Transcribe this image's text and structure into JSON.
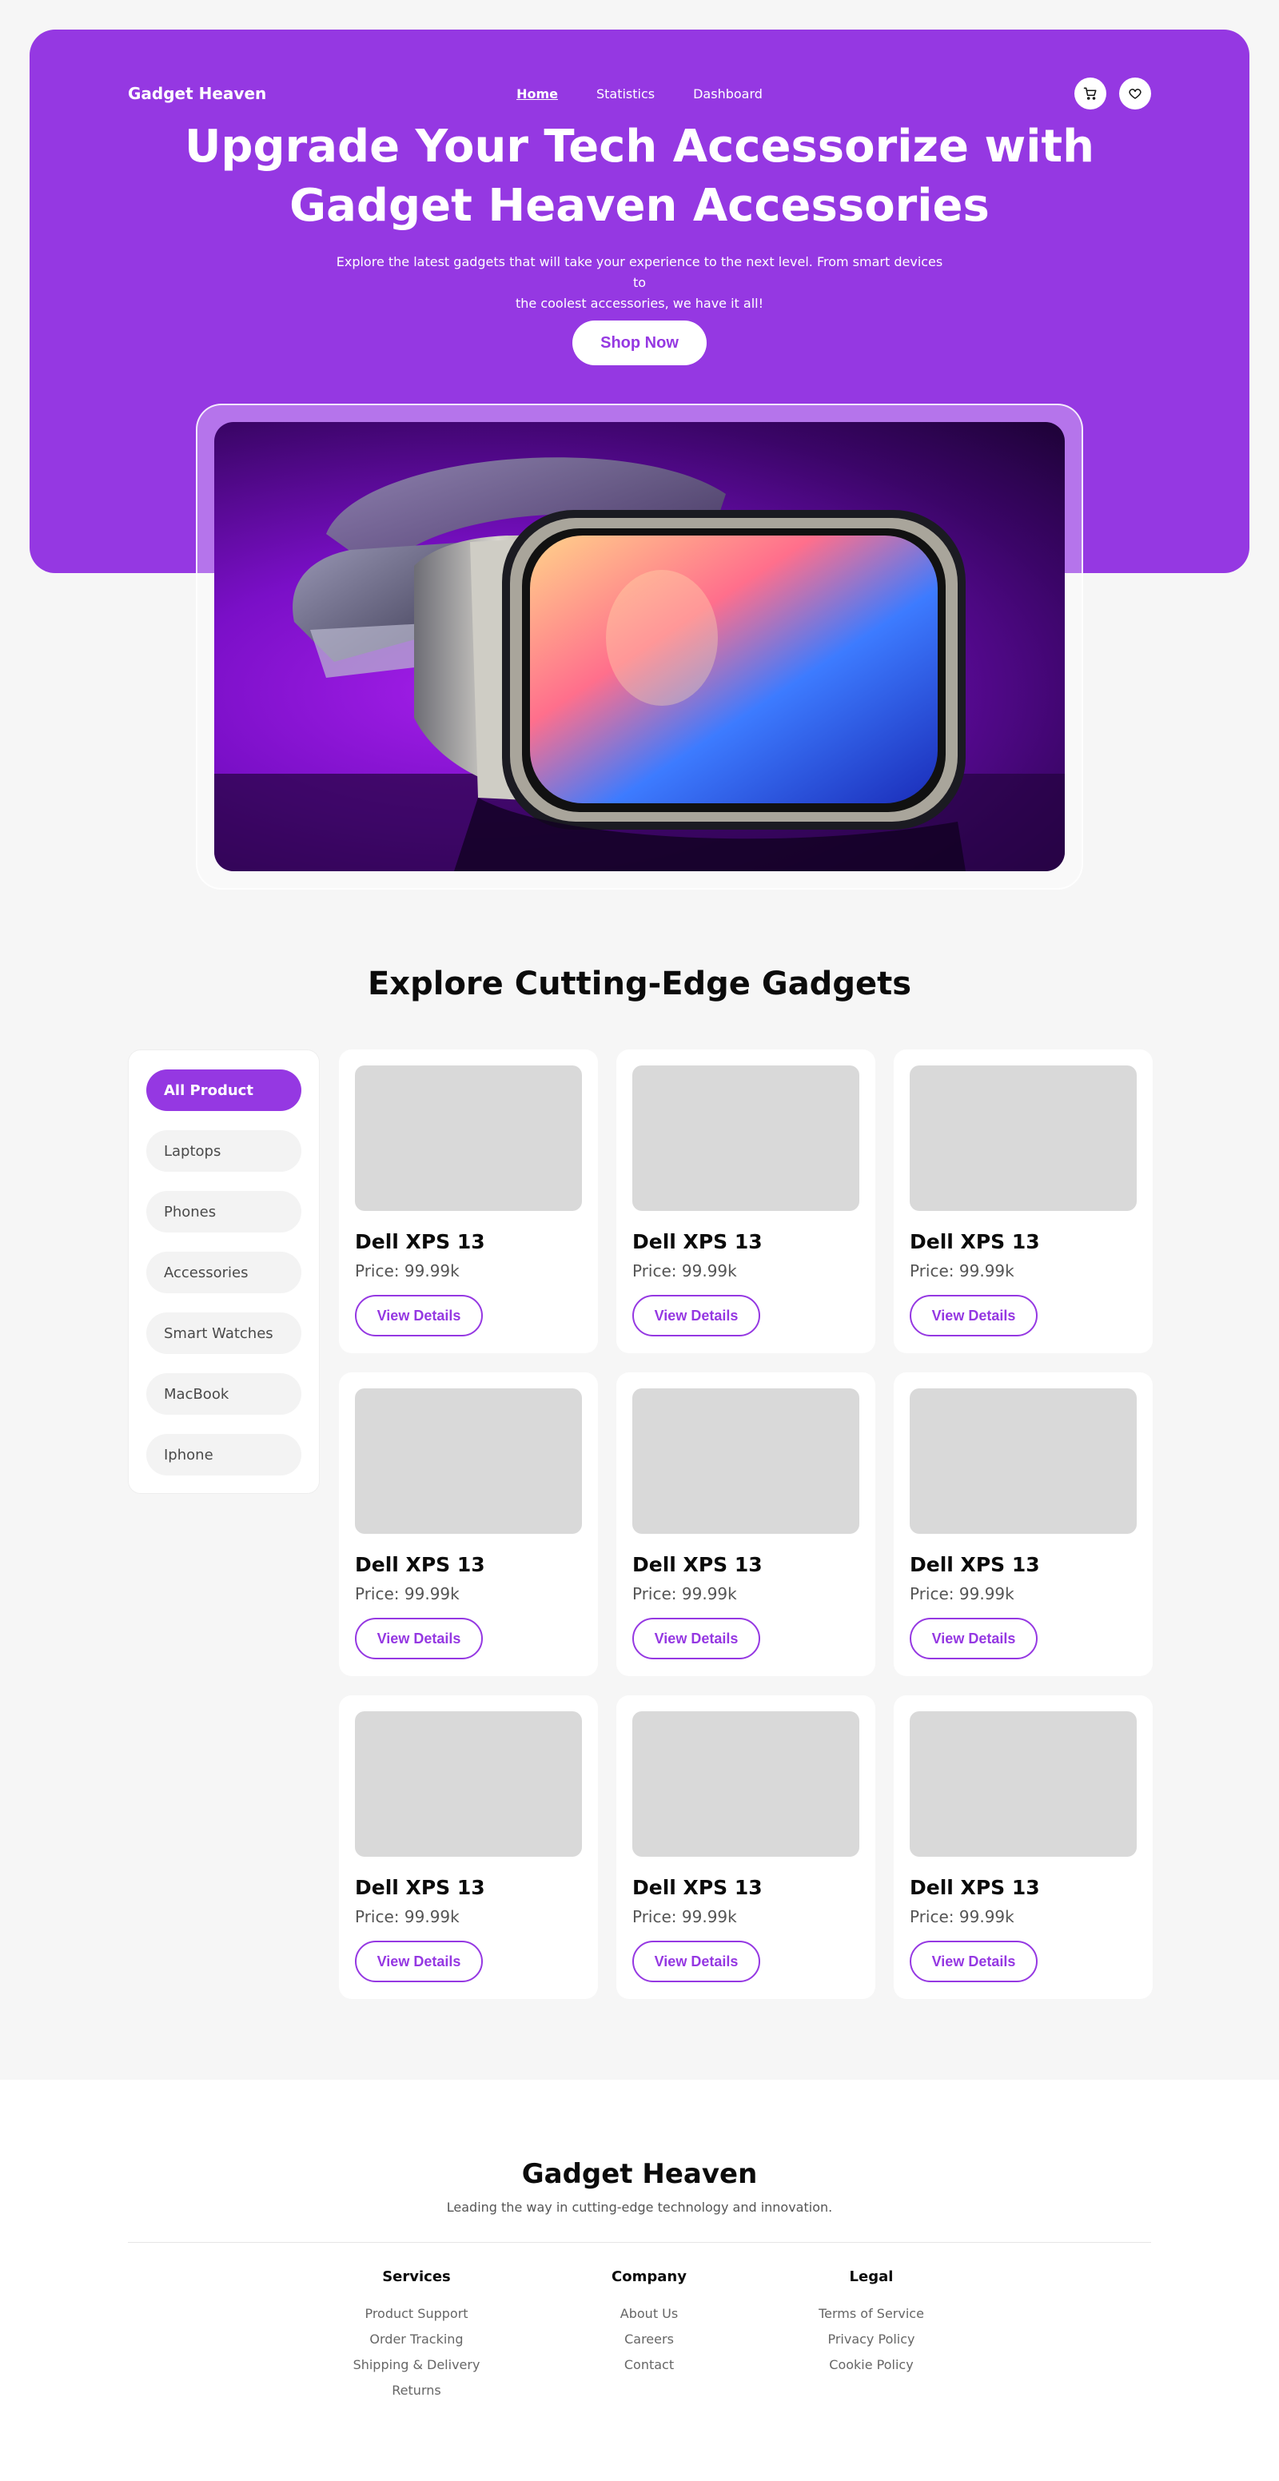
{
  "nav": {
    "brand": "Gadget Heaven",
    "links": [
      "Home",
      "Statistics",
      "Dashboard"
    ],
    "icons": [
      "cart-icon",
      "heart-icon"
    ]
  },
  "hero": {
    "title_line1": "Upgrade Your Tech Accessorize with",
    "title_line2": "Gadget Heaven Accessories",
    "subtitle_line1": "Explore the latest gadgets that will take your experience to the next level. From smart devices to",
    "subtitle_line2": "the coolest accessories, we have it all!",
    "cta": "Shop Now"
  },
  "explore": {
    "title": "Explore Cutting-Edge Gadgets",
    "categories": [
      "All Product",
      "Laptops",
      "Phones",
      "Accessories",
      "Smart Watches",
      "MacBook",
      "Iphone"
    ],
    "products": [
      {
        "name": "Dell XPS 13",
        "price": "Price: 99.99k",
        "button": "View Details"
      },
      {
        "name": "Dell XPS 13",
        "price": "Price: 99.99k",
        "button": "View Details"
      },
      {
        "name": "Dell XPS 13",
        "price": "Price: 99.99k",
        "button": "View Details"
      },
      {
        "name": "Dell XPS 13",
        "price": "Price: 99.99k",
        "button": "View Details"
      },
      {
        "name": "Dell XPS 13",
        "price": "Price: 99.99k",
        "button": "View Details"
      },
      {
        "name": "Dell XPS 13",
        "price": "Price: 99.99k",
        "button": "View Details"
      },
      {
        "name": "Dell XPS 13",
        "price": "Price: 99.99k",
        "button": "View Details"
      },
      {
        "name": "Dell XPS 13",
        "price": "Price: 99.99k",
        "button": "View Details"
      },
      {
        "name": "Dell XPS 13",
        "price": "Price: 99.99k",
        "button": "View Details"
      }
    ]
  },
  "footer": {
    "brand": "Gadget Heaven",
    "tagline": "Leading the way in cutting-edge technology and innovation.",
    "columns": [
      {
        "title": "Services",
        "links": [
          "Product Support",
          "Order Tracking",
          "Shipping & Delivery",
          "Returns"
        ]
      },
      {
        "title": "Company",
        "links": [
          "About Us",
          "Careers",
          "Contact"
        ]
      },
      {
        "title": "Legal",
        "links": [
          "Terms of Service",
          "Privacy Policy",
          "Cookie Policy"
        ]
      }
    ]
  },
  "colors": {
    "accent": "#9538e2",
    "background": "#f6f6f6",
    "placeholder": "#d9d9d9"
  }
}
